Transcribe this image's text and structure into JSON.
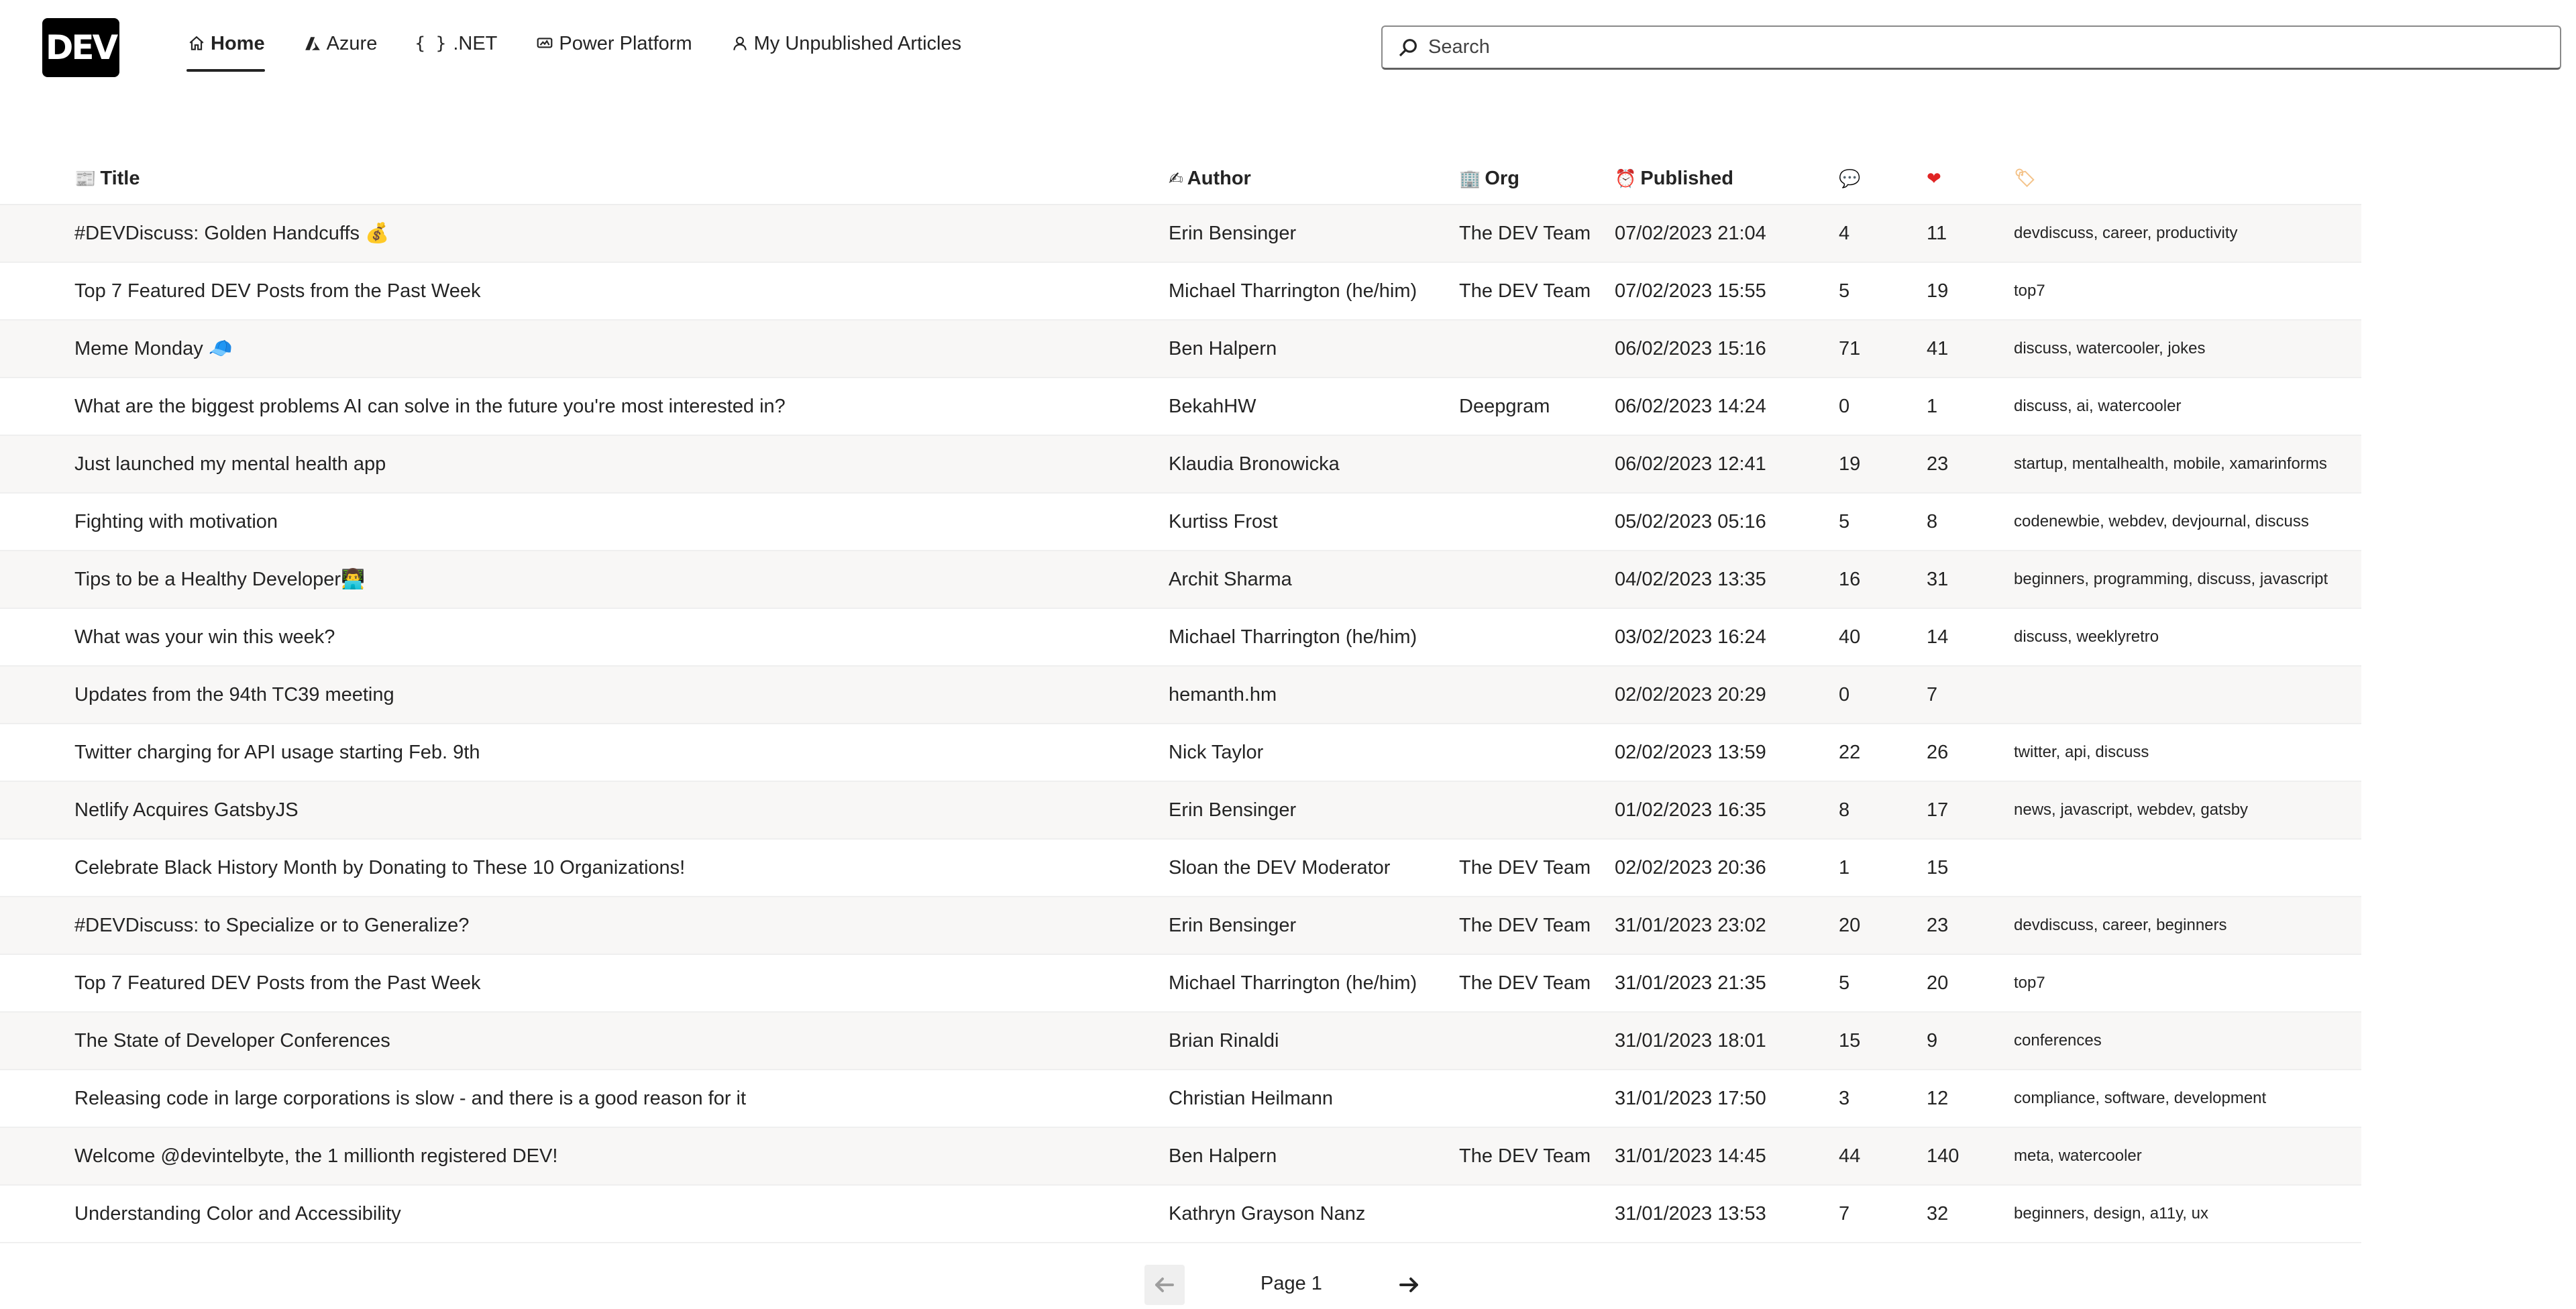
{
  "header": {
    "logo_text": "DEV",
    "nav": [
      {
        "label": "Home",
        "icon": "home-icon"
      },
      {
        "label": "Azure",
        "icon": "azure-icon"
      },
      {
        "label": ".NET",
        "icon": "braces-icon",
        "glyph": "{ }"
      },
      {
        "label": "Power Platform",
        "icon": "power-platform-icon"
      },
      {
        "label": "My Unpublished Articles",
        "icon": "person-icon"
      }
    ],
    "active_nav": "Home",
    "search_placeholder": "Search"
  },
  "table": {
    "columns": [
      {
        "key": "title",
        "label": "Title",
        "icon": "newspaper-icon",
        "glyph": "📰"
      },
      {
        "key": "author",
        "label": "Author",
        "icon": "writing-hand-icon",
        "glyph": "✍"
      },
      {
        "key": "org",
        "label": "Org",
        "icon": "office-building-icon",
        "glyph": "🏢"
      },
      {
        "key": "published",
        "label": "Published",
        "icon": "alarm-clock-icon",
        "glyph": "⏰"
      },
      {
        "key": "comments",
        "label": "",
        "icon": "speech-bubble-icon",
        "glyph": "💬"
      },
      {
        "key": "reactions",
        "label": "",
        "icon": "heart-icon",
        "glyph": "❤"
      },
      {
        "key": "tags",
        "label": "",
        "icon": "tag-icon",
        "glyph": "🏷"
      }
    ],
    "rows": [
      {
        "title": "#DEVDiscuss: Golden Handcuffs 💰",
        "author": "Erin Bensinger",
        "org": "The DEV Team",
        "published": "07/02/2023 21:04",
        "comments": "4",
        "reactions": "11",
        "tags": "devdiscuss, career, productivity"
      },
      {
        "title": "Top 7 Featured DEV Posts from the Past Week",
        "author": "Michael Tharrington (he/him)",
        "org": "The DEV Team",
        "published": "07/02/2023 15:55",
        "comments": "5",
        "reactions": "19",
        "tags": "top7"
      },
      {
        "title": "Meme Monday 🧢",
        "author": "Ben Halpern",
        "org": "",
        "published": "06/02/2023 15:16",
        "comments": "71",
        "reactions": "41",
        "tags": "discuss, watercooler, jokes"
      },
      {
        "title": "What are the biggest problems AI can solve in the future you're most interested in?",
        "author": "BekahHW",
        "org": "Deepgram",
        "published": "06/02/2023 14:24",
        "comments": "0",
        "reactions": "1",
        "tags": "discuss, ai, watercooler"
      },
      {
        "title": "Just launched my mental health app",
        "author": "Klaudia Bronowicka",
        "org": "",
        "published": "06/02/2023 12:41",
        "comments": "19",
        "reactions": "23",
        "tags": "startup, mentalhealth, mobile, xamarinforms"
      },
      {
        "title": "Fighting with motivation",
        "author": "Kurtiss Frost",
        "org": "",
        "published": "05/02/2023 05:16",
        "comments": "5",
        "reactions": "8",
        "tags": "codenewbie, webdev, devjournal, discuss"
      },
      {
        "title": "Tips to be a Healthy Developer👨‍💻",
        "author": "Archit Sharma",
        "org": "",
        "published": "04/02/2023 13:35",
        "comments": "16",
        "reactions": "31",
        "tags": "beginners, programming, discuss, javascript"
      },
      {
        "title": "What was your win this week?",
        "author": "Michael Tharrington (he/him)",
        "org": "",
        "published": "03/02/2023 16:24",
        "comments": "40",
        "reactions": "14",
        "tags": "discuss, weeklyretro"
      },
      {
        "title": "Updates from the 94th TC39 meeting",
        "author": "hemanth.hm",
        "org": "",
        "published": "02/02/2023 20:29",
        "comments": "0",
        "reactions": "7",
        "tags": ""
      },
      {
        "title": "Twitter charging for API usage starting Feb. 9th",
        "author": "Nick Taylor",
        "org": "",
        "published": "02/02/2023 13:59",
        "comments": "22",
        "reactions": "26",
        "tags": "twitter, api, discuss"
      },
      {
        "title": "Netlify Acquires GatsbyJS",
        "author": "Erin Bensinger",
        "org": "",
        "published": "01/02/2023 16:35",
        "comments": "8",
        "reactions": "17",
        "tags": "news, javascript, webdev, gatsby"
      },
      {
        "title": "Celebrate Black History Month by Donating to These 10 Organizations!",
        "author": "Sloan the DEV Moderator",
        "org": "The DEV Team",
        "published": "02/02/2023 20:36",
        "comments": "1",
        "reactions": "15",
        "tags": ""
      },
      {
        "title": "#DEVDiscuss: to Specialize or to Generalize?",
        "author": "Erin Bensinger",
        "org": "The DEV Team",
        "published": "31/01/2023 23:02",
        "comments": "20",
        "reactions": "23",
        "tags": "devdiscuss, career, beginners"
      },
      {
        "title": "Top 7 Featured DEV Posts from the Past Week",
        "author": "Michael Tharrington (he/him)",
        "org": "The DEV Team",
        "published": "31/01/2023 21:35",
        "comments": "5",
        "reactions": "20",
        "tags": "top7"
      },
      {
        "title": "The State of Developer Conferences",
        "author": "Brian Rinaldi",
        "org": "",
        "published": "31/01/2023 18:01",
        "comments": "15",
        "reactions": "9",
        "tags": "conferences"
      },
      {
        "title": "Releasing code in large corporations is slow - and there is a good reason for it",
        "author": "Christian Heilmann",
        "org": "",
        "published": "31/01/2023 17:50",
        "comments": "3",
        "reactions": "12",
        "tags": "compliance, software, development"
      },
      {
        "title": "Welcome @devintelbyte, the 1 millionth registered DEV!",
        "author": "Ben Halpern",
        "org": "The DEV Team",
        "published": "31/01/2023 14:45",
        "comments": "44",
        "reactions": "140",
        "tags": "meta, watercooler"
      },
      {
        "title": "Understanding Color and Accessibility",
        "author": "Kathryn Grayson Nanz",
        "org": "",
        "published": "31/01/2023 13:53",
        "comments": "7",
        "reactions": "32",
        "tags": "beginners, design, a11y, ux"
      }
    ]
  },
  "pagination": {
    "label": "Page 1",
    "prev_icon": "arrow-left-icon",
    "next_icon": "arrow-right-icon",
    "prev_enabled": false
  }
}
